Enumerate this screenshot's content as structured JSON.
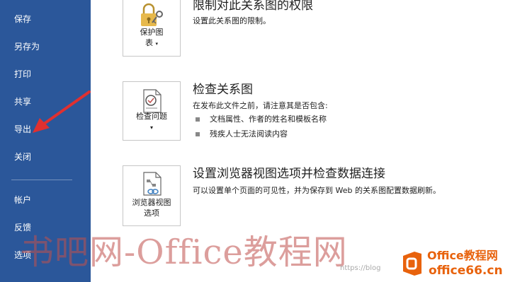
{
  "sidebar": {
    "items": [
      {
        "label": "保存"
      },
      {
        "label": "另存为"
      },
      {
        "label": "打印"
      },
      {
        "label": "共享"
      },
      {
        "label": "导出"
      },
      {
        "label": "关闭"
      },
      {
        "label": "帐户"
      },
      {
        "label": "反馈"
      },
      {
        "label": "选项"
      }
    ]
  },
  "sections": [
    {
      "tile_line1": "保护图",
      "tile_line2": "表",
      "title": "限制对此关系图的权限",
      "desc": "设置此关系图的限制。"
    },
    {
      "tile_label": "检查问题",
      "title": "检查关系图",
      "desc": "在发布此文件之前，请注意其是否包含:",
      "bullets": [
        "文档属性、作者的姓名和模板名称",
        "残疾人士无法阅读内容"
      ]
    },
    {
      "tile_line1": "浏览器视图",
      "tile_line2": "选项",
      "title": "设置浏览器视图选项并检查数据连接",
      "desc": "可以设置单个页面的可见性，并为保存到 Web 的关系图配置数据刷新。"
    }
  ],
  "watermark": "书吧网-Office教程网",
  "watermark_blog": "https://blog",
  "logo": {
    "line1": "Office教程网",
    "line2": "office66.cn"
  },
  "colors": {
    "sidebar": "#2b579a",
    "arrow": "#e03030",
    "logo_orange": "#e8620c"
  }
}
